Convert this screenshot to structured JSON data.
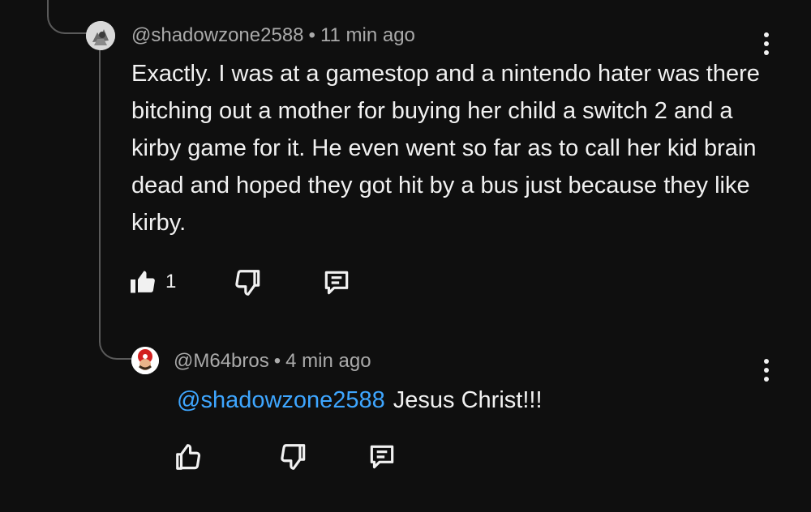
{
  "comment": {
    "author": "@shadowzone2588",
    "separator": "•",
    "time": "11 min ago",
    "text": "Exactly. I was at a gamestop and a nintendo hater was there bitching out a mother for buying her child a switch 2 and a kirby game for it. He even went so far as to call her kid brain dead and hoped they got hit by a bus just because they like kirby.",
    "like_count": "1",
    "icons": {
      "like": "thumbs-up-filled-icon",
      "dislike": "thumbs-down-icon",
      "reply": "reply-comment-icon",
      "more": "more-vert-icon"
    }
  },
  "reply": {
    "author": "@M64bros",
    "separator": "•",
    "time": "4 min ago",
    "mention": "@shadowzone2588",
    "text": "Jesus Christ!!!",
    "icons": {
      "like": "thumbs-up-outline-icon",
      "dislike": "thumbs-down-icon",
      "reply": "reply-comment-icon",
      "more": "more-vert-icon"
    }
  },
  "colors": {
    "background": "#0f0f0f",
    "text": "#f1f1f1",
    "meta": "#aaaaaa",
    "mention": "#3ea6ff",
    "thread_line": "#5a5a5a"
  }
}
